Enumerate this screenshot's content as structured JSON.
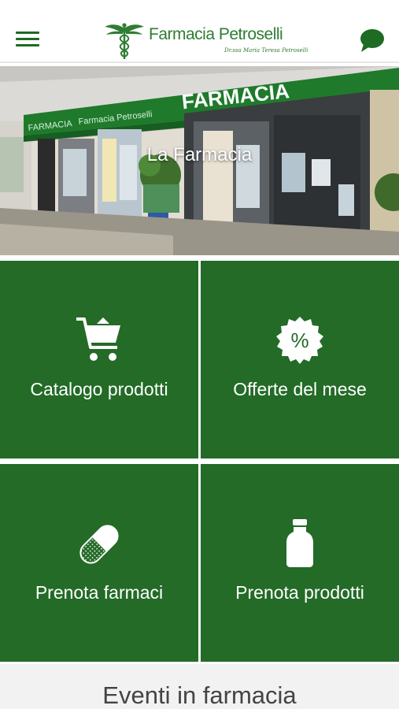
{
  "header": {
    "brand_name": "Farmacia Petroselli",
    "brand_subtitle": "Dr.ssa Maria Teresa Petroselli",
    "menu_icon": "hamburger-menu-icon",
    "chat_icon": "chat-bubble-icon",
    "brand_color": "#2e7d32"
  },
  "banner": {
    "title": "La Farmacia",
    "storefront_sign": "FARMACIA"
  },
  "tiles": [
    {
      "label": "Catalogo prodotti",
      "icon": "shopping-cart-icon"
    },
    {
      "label": "Offerte del mese",
      "icon": "percent-badge-icon",
      "icon_text": "%"
    },
    {
      "label": "Prenota farmaci",
      "icon": "pill-capsule-icon"
    },
    {
      "label": "Prenota prodotti",
      "icon": "bottle-icon"
    }
  ],
  "events": {
    "title": "Eventi in farmacia"
  },
  "colors": {
    "tile_green": "#236b27",
    "header_green": "#1e6b23",
    "events_background": "#f2f2f2"
  }
}
